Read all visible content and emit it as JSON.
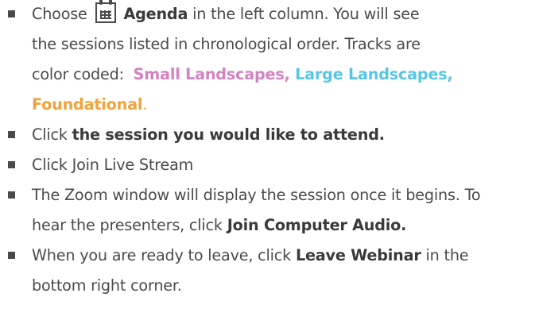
{
  "steps": {
    "s1": {
      "choose": "Choose",
      "icon": "calendar-icon",
      "agenda": "Agenda",
      "line1_rest": " in the left column. You will see",
      "line2": "the sessions listed in chronological order. Tracks are",
      "line3_prefix": "color coded:  ",
      "small": "Small Landscapes,",
      "large": " Large Landscapes,",
      "foundational": "Foundational",
      "period": "."
    },
    "s2": {
      "prefix": "Click ",
      "bold": "the session you would like to attend."
    },
    "s3": {
      "text": "Click Join Live Stream"
    },
    "s4": {
      "line1": "The Zoom window will display the session once it begins. To",
      "line2_prefix": "hear the presenters, click ",
      "bold": "Join Computer Audio."
    },
    "s5": {
      "prefix": "When you are ready to leave, click ",
      "bold": "Leave Webinar",
      "suffix": " in the",
      "line2": "bottom right corner."
    }
  },
  "colors": {
    "text": "#4a4a4a",
    "small_landscapes": "#d482c2",
    "large_landscapes": "#57c6e6",
    "foundational": "#f2a23c"
  }
}
